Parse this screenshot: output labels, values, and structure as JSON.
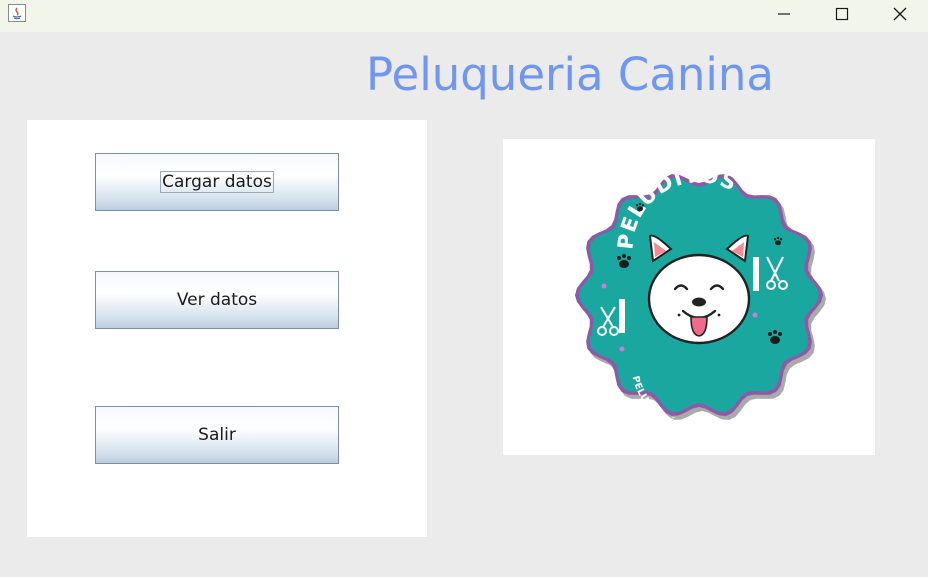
{
  "window": {
    "controls": {
      "minimize_icon": "minimize-icon",
      "maximize_icon": "maximize-icon",
      "close_icon": "close-icon"
    }
  },
  "app": {
    "title": "Peluqueria Canina"
  },
  "menu": {
    "load_label": "Cargar datos",
    "view_label": "Ver datos",
    "exit_label": "Salir"
  },
  "logo": {
    "brand": "PELUDITOS",
    "subtitle": "PELUQUERÍA CANINA",
    "colors": {
      "badge": "#1aa7a0",
      "badge_border": "#8e5aa8",
      "paw": "#1b1b1b"
    }
  }
}
